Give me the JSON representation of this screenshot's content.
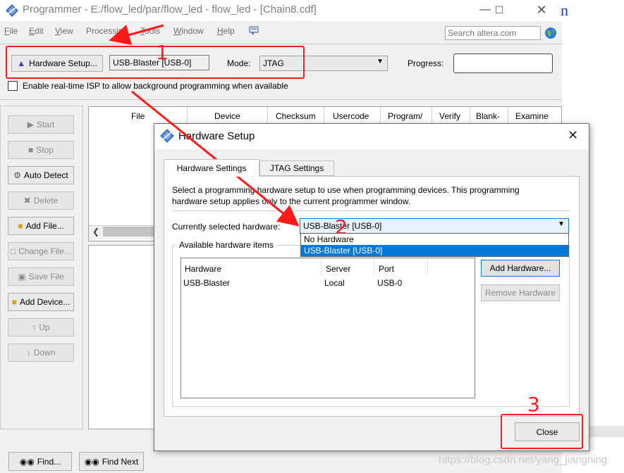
{
  "window": {
    "title": "Programmer - E:/flow_led/par/flow_led - flow_led - [Chain8.cdf]"
  },
  "menu": {
    "items": [
      {
        "u": "F",
        "rest": "ile"
      },
      {
        "u": "E",
        "rest": "dit"
      },
      {
        "u": "V",
        "rest": "iew"
      },
      {
        "u": "",
        "rest": "Processing"
      },
      {
        "u": "T",
        "rest": "ools"
      },
      {
        "u": "W",
        "rest": "indow"
      },
      {
        "u": "H",
        "rest": "elp"
      }
    ],
    "search_placeholder": "Search altera.com"
  },
  "toolbar": {
    "hardware_setup_label": "Hardware Setup...",
    "hardware_value": "USB-Blaster [USB-0]",
    "mode_label": "Mode:",
    "mode_value": "JTAG",
    "progress_label": "Progress:",
    "isp_label": "Enable real-time ISP to allow background programming when available"
  },
  "side_buttons": [
    "Start",
    "Stop",
    "Auto Detect",
    "Delete",
    "Add File...",
    "Change File...",
    "Save File",
    "Add Device...",
    "Up",
    "Down"
  ],
  "table": {
    "columns": [
      "File",
      "Device",
      "Checksum",
      "Usercode",
      "Program/",
      "Verify",
      "Blank-",
      "Examine"
    ]
  },
  "bottom_buttons": {
    "find": "Find...",
    "find_next": "Find Next"
  },
  "dialog": {
    "title": "Hardware Setup",
    "tabs": [
      "Hardware Settings",
      "JTAG Settings"
    ],
    "description_line1": "Select a programming hardware setup to use when programming devices. This programming",
    "description_line2": "hardware setup applies only to the current programmer window.",
    "current_label": "Currently selected hardware:",
    "current_value": "USB-Blaster [USB-0]",
    "dropdown_options": [
      "No Hardware",
      "USB-Blaster [USB-0]"
    ],
    "available_label": "Available hardware items",
    "hw_columns": [
      "Hardware",
      "Server",
      "Port"
    ],
    "hw_rows": [
      {
        "hardware": "USB-Blaster",
        "server": "Local",
        "port": "USB-0"
      }
    ],
    "add_button": "Add Hardware...",
    "remove_button": "Remove Hardware",
    "close_button": "Close"
  },
  "annotations": {
    "step1": "1",
    "step2": "2",
    "step3": "3",
    "color": "#ff1a1a"
  },
  "watermark": "https://blog.csdn.net/yang_jiangning",
  "edge_letter": "n"
}
